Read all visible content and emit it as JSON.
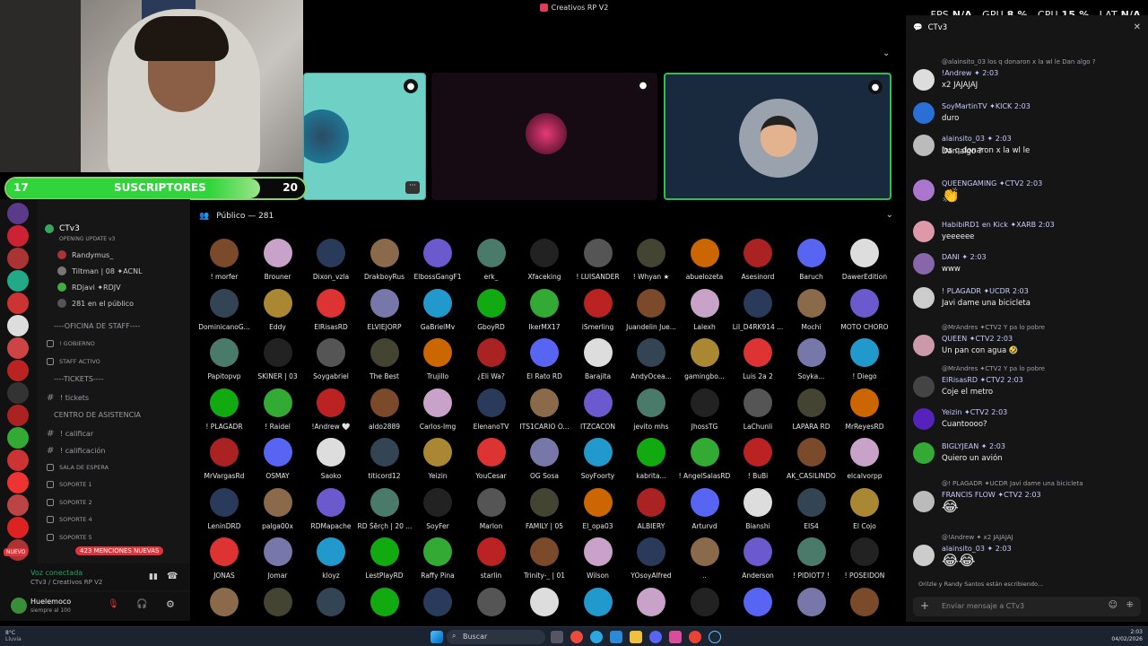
{
  "window_title": "Creativos RP V2",
  "perf": {
    "fps_label": "FPS",
    "fps": "N/A",
    "gpu_label": "GPU",
    "gpu": "8 %",
    "cpu_label": "CPU",
    "cpu": "15 %",
    "lat_label": "LAT",
    "lat": "N/A"
  },
  "subs": {
    "left": "17",
    "label": "SUSCRIPTORES",
    "right": "20",
    "progress": 0.85
  },
  "server": {
    "name": "CTv3",
    "sub": "OPENING UPDATE v3"
  },
  "voice_members": [
    "Randymus_",
    "Tiltman | 08 ✦ACNL",
    "RDjavi ✦RDJV",
    "281 en el público"
  ],
  "channels": [
    {
      "type": "cat",
      "label": "----OFICINA DE STAFF----"
    },
    {
      "type": "lk",
      "label": "! GOBIERNO"
    },
    {
      "type": "lk",
      "label": "STAFF ACTIVO"
    },
    {
      "type": "cat",
      "label": "----TICKETS----"
    },
    {
      "type": "h",
      "label": "! tickets"
    },
    {
      "type": "cat",
      "label": "CENTRO DE ASISTENCIA"
    },
    {
      "type": "h",
      "label": "! calificar"
    },
    {
      "type": "h",
      "label": "! calificación"
    },
    {
      "type": "lk",
      "label": "SALA DE ESPERA"
    },
    {
      "type": "lk",
      "label": "SOPORTE 1"
    },
    {
      "type": "lk",
      "label": "SOPORTE 2"
    },
    {
      "type": "lk",
      "label": "SOPORTE 4"
    },
    {
      "type": "lk",
      "label": "SOPORTE 5"
    }
  ],
  "mentions": "423 MENCIONES NUEVAS",
  "new_badge": "NUEVO",
  "voice": {
    "status": "Voz conectada",
    "where": "CTv3 / Creativos RP V2"
  },
  "user": {
    "name": "Huelemoco",
    "status": "siempre al 100"
  },
  "public": {
    "label": "Público — 281"
  },
  "members": [
    [
      "! morfer",
      "Brouner",
      "Dixon_vzla",
      "DrakboyRus",
      "ElbossGangF1",
      "erk_",
      "Xfaceking",
      "! LUISANDER",
      "! Whyan ★",
      "abuelozeta",
      "Asesinord",
      "Baruch",
      "DawerEdition"
    ],
    [
      "DominicanoG...",
      "Eddy",
      "ElRisasRD",
      "ELVIEJORP",
      "GaBrielMv",
      "GboyRD",
      "IkerMX17",
      "iSmerling",
      "Juandelin Jue...",
      "Lalexh",
      "Lil_D4RK914 ...",
      "Mochi",
      "MOTO CHORO"
    ],
    [
      "Papitopvp",
      "SKINER | 03",
      "Soygabriel",
      "The Best",
      "Trujillo",
      "¿Eli Wa?",
      "El Rato RD",
      "Barajita",
      "AndyOcea...",
      "gamingbo...",
      "Luis 2a 2",
      "Soyka...",
      "! Diego"
    ],
    [
      "! PLAGADR",
      "! Raidel",
      "!Andrew 🤍",
      "aldo2889",
      "Carlos-Img",
      "ElenanoTV",
      "ITS1CARIO O...",
      "ITZCACON",
      "jevito mhs",
      "JhossTG",
      "LaChunli",
      "LAPARA RD",
      "MrReyesRD"
    ],
    [
      "MrVargasRd",
      "OSMAY",
      "Saoko",
      "titicord12",
      "Yeizin",
      "YouCesar",
      "OG Sosa",
      "SoyFoorty",
      "kabrita...",
      "! AngelSalasRD",
      "! BuBi",
      "AK_CASILINDO",
      "elcalvorpp"
    ],
    [
      "LeninDRD",
      "palga00x",
      "RDMapache",
      "RD Šērçh | 20 ...",
      "SoyFer",
      "Marlon",
      "FAMILY | 05",
      "El_opa03",
      "ALBIERY",
      "Arturvd",
      "Bianshi",
      "EIS4",
      "El Cojo"
    ],
    [
      "JONAS",
      "Jomar",
      "kloyz",
      "LestPlayRD",
      "Raffy Pina",
      "starlin",
      "Trinity-_ | 01",
      "Wilson",
      "YOsoyAlfred",
      "..",
      "Anderson",
      "! PIDIOT7 !",
      "! POSEIDON"
    ]
  ],
  "chat_title": "CTv3",
  "chat": [
    {
      "reply": "@alainsito_03 los q donaron x la wl le Dan algo ?",
      "name": "!Andrew ✦ 2:03",
      "text": "x2 JAJAJAJ"
    },
    {
      "reply": "",
      "name": "SoyMartinTV ✦KICK 2:03",
      "text": "duro"
    },
    {
      "reply": "",
      "name": "alainsito_03 ✦ 2:03",
      "text": "los q donaron x la wl le"
    },
    {
      "reply": "",
      "name": "",
      "text": "Dan algo ?"
    },
    {
      "reply": "",
      "name": "QUEENGAMING ✦CTV2 2:03",
      "text": "👏"
    },
    {
      "reply": "",
      "name": "HabibiRD1 en Kick ✦XARB 2:03",
      "text": "yeeeeee"
    },
    {
      "reply": "",
      "name": "DANI ✦ 2:03",
      "text": "www"
    },
    {
      "reply": "",
      "name": "! PLAGADR ✦UCDR 2:03",
      "text": "Javi dame una bicicleta"
    },
    {
      "reply": "@MrAndres ✦CTV2 Y pa lo pobre",
      "name": "QUEEN ✦CTV2 2:03",
      "text": "Un pan con agua 🤣"
    },
    {
      "reply": "@MrAndres ✦CTV2 Y pa lo pobre",
      "name": "ElRisasRD ✦CTV2 2:03",
      "text": "Coje el metro"
    },
    {
      "reply": "",
      "name": "Yeizin ✦CTV2 2:03",
      "text": "Cuantoooo?"
    },
    {
      "reply": "",
      "name": "BIGLYJEAN ✦ 2:03",
      "text": "Quiero un avión"
    },
    {
      "reply": "@! PLAGADR ✦UCDR Javi dame una bicicleta",
      "name": "FRANCIS FLOW ✦CTV2 2:03",
      "text": "😂"
    },
    {
      "reply": "@!Andrew ✦ x2 JAJAJAJ",
      "name": "alainsito_03 ✦ 2:03",
      "text": "😂😂"
    }
  ],
  "typing": "Orilzle y Randy Santos están escribiendo...",
  "chat_placeholder": "Enviar mensaje a CTv3",
  "weather": {
    "temp": "8°C",
    "cond": "Lluvia"
  },
  "search": "Buscar",
  "clock": {
    "time": "2:03",
    "date": "04/02/2026"
  }
}
